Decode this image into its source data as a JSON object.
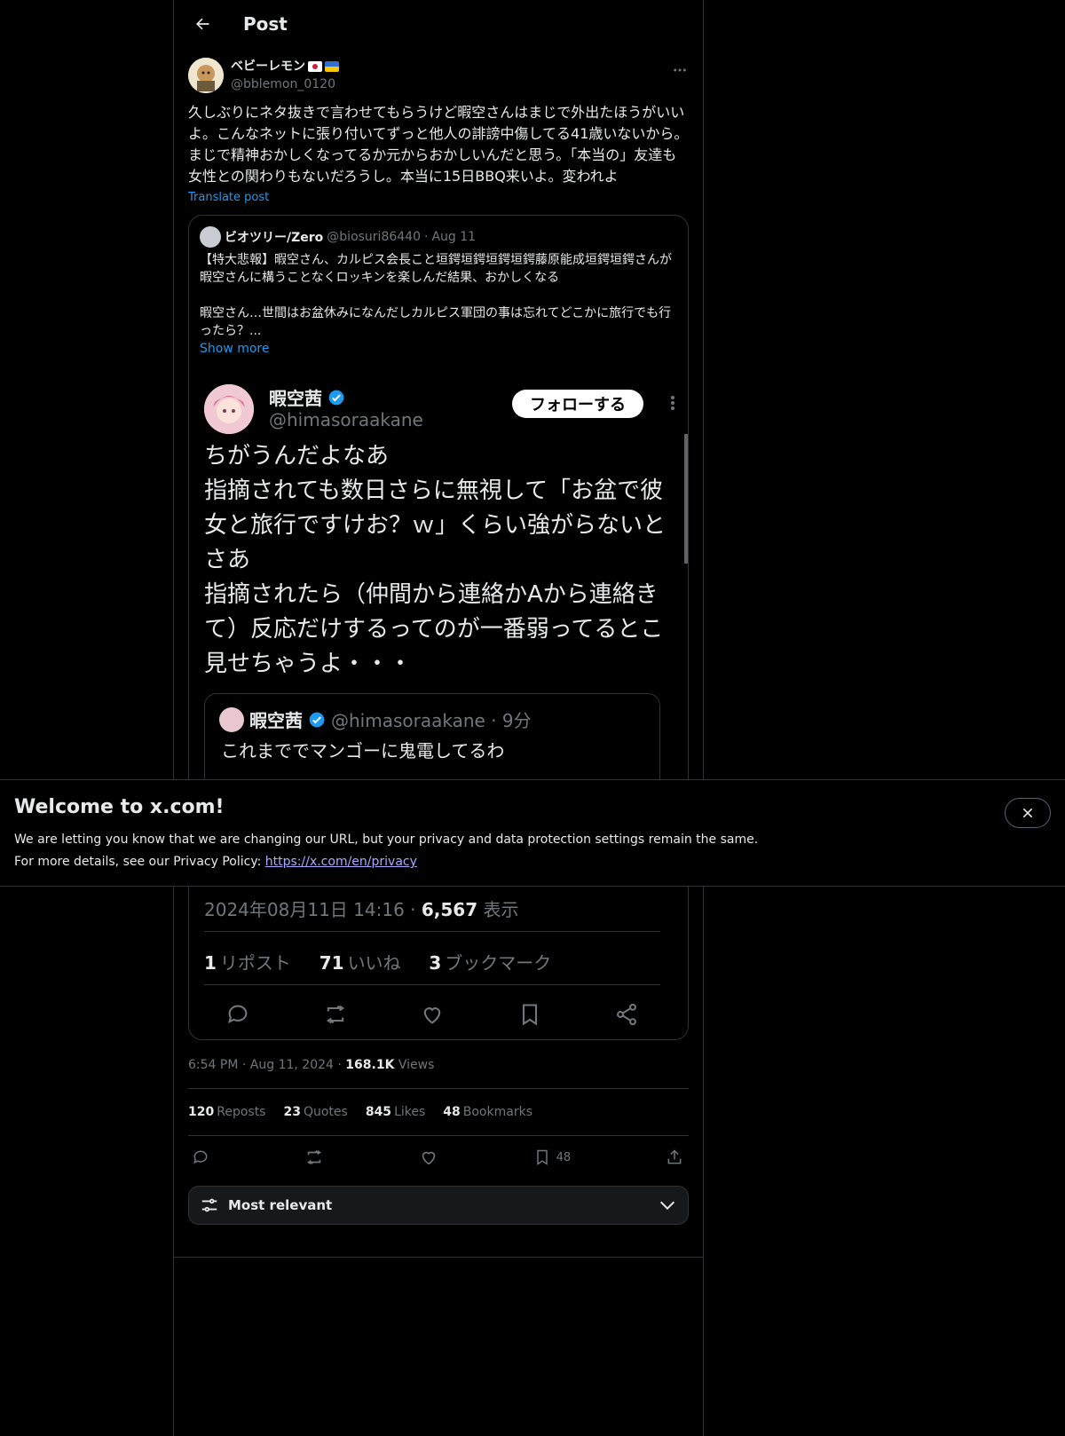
{
  "header": {
    "title": "Post"
  },
  "post": {
    "display_name": "ベビーレモン",
    "handle": "@bblemon_0120",
    "text": "久しぶりにネタ抜きで言わせてもらうけど暇空さんはまじで外出たほうがいいよ。こんなネットに張り付いてずっと他人の誹謗中傷してる41歳いないから。まじで精神おかしくなってるか元からおかしいんだと思う。「本当の」友達も女性との関わりもないだろうし。本当に15日BBQ来いよ。変われよ",
    "translate_label": "Translate post",
    "time": "6:54 PM",
    "date": "Aug 11, 2024",
    "views_count": "168.1K",
    "views_label": "Views",
    "reposts_count": "120",
    "reposts_label": "Reposts",
    "quotes_count": "23",
    "quotes_label": "Quotes",
    "likes_count": "845",
    "likes_label": "Likes",
    "bookmarks_count": "48",
    "bookmarks_label": "Bookmarks",
    "bookmark_action_count": "48"
  },
  "quote": {
    "display_name": "ビオツリー/Zero",
    "handle": "@biosuri86440",
    "date": "Aug 11",
    "text": "【特大悲報】暇空さん、カルピス会長こと垣鍔垣鍔垣鍔垣鍔藤原能成垣鍔垣鍔さんが暇空さんに構うことなくロッキンを楽しんだ結果、おかしくなる\n\n暇空さん…世間はお盆休みになんだしカルピス軍団の事は忘れてどこかに旅行でも行ったら？...",
    "show_more": "Show more"
  },
  "screenshot": {
    "name": "暇空茜",
    "handle": "@himasoraakane",
    "follow_label": "フォローする",
    "text": "ちがうんだよなあ\n指摘されても数日さらに無視して「お盆で彼女と旅行ですけお？ｗ」くらい強がらないとさあ\n指摘されたら（仲間から連絡かAから連絡きて）反応だけするってのが一番弱ってるとこ見せちゃうよ・・・",
    "inner_name": "暇空茜",
    "inner_handle": "@himasoraakane · 9分",
    "inner_text": "これまででマンゴーに鬼電してるわ",
    "date_time": "2024年08月11日 14:16 · ",
    "views": "6,567",
    "views_label": "表示",
    "reposts": "1",
    "reposts_label": "リポスト",
    "likes": "71",
    "likes_label": "いいね",
    "bookmarks": "3",
    "bookmarks_label": "ブックマーク"
  },
  "sort": {
    "label": "Most relevant"
  },
  "banner": {
    "title": "Welcome to x.com!",
    "line1": "We are letting you know that we are changing our URL, but your privacy and data protection settings remain the same.",
    "line2": "For more details, see our Privacy Policy: ",
    "link": "https://x.com/en/privacy"
  },
  "colors": {
    "background": "#000000",
    "accent": "#1d9bf0",
    "border": "#2f3336",
    "muted": "#71767b"
  }
}
